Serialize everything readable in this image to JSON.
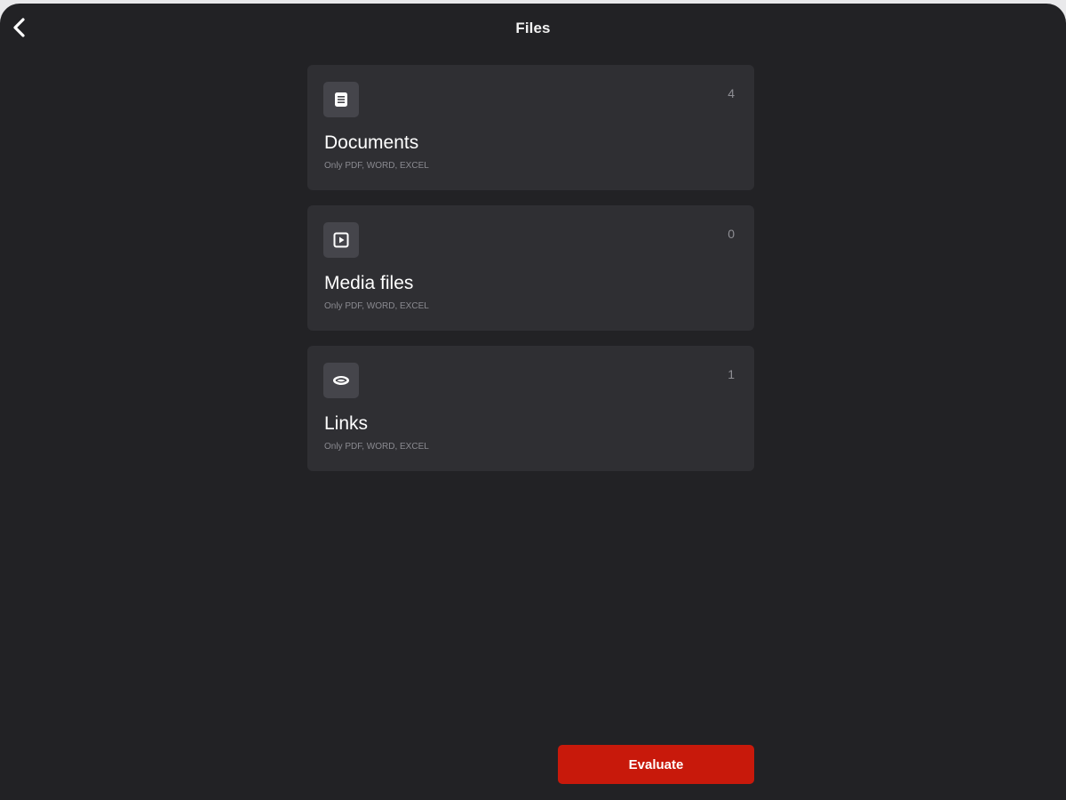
{
  "header": {
    "title": "Files",
    "back_icon": "chevron-left-icon"
  },
  "cards": [
    {
      "icon": "document-icon",
      "title": "Documents",
      "subtitle": "Only PDF, WORD, EXCEL",
      "count": "4"
    },
    {
      "icon": "media-play-icon",
      "title": "Media files",
      "subtitle": "Only PDF, WORD, EXCEL",
      "count": "0"
    },
    {
      "icon": "link-icon",
      "title": "Links",
      "subtitle": "Only PDF, WORD, EXCEL",
      "count": "1"
    }
  ],
  "footer": {
    "evaluate_label": "Evaluate"
  },
  "colors": {
    "background": "#222225",
    "card": "#2f2f33",
    "accent": "#c8190b"
  }
}
